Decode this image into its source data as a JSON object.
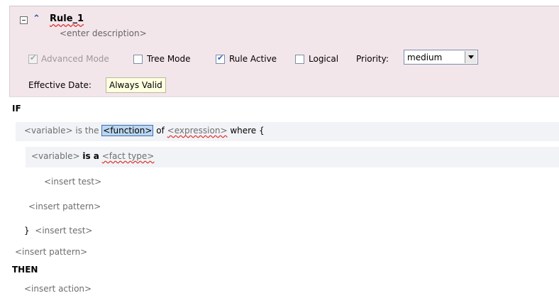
{
  "rule": {
    "name": "Rule_1",
    "description": "<enter description>",
    "options": {
      "advanced_mode": {
        "label": "Advanced Mode",
        "checked": true,
        "disabled": true
      },
      "tree_mode": {
        "label": "Tree Mode",
        "checked": false
      },
      "rule_active": {
        "label": "Rule Active",
        "checked": true
      },
      "logical": {
        "label": "Logical",
        "checked": false
      }
    },
    "priority": {
      "label": "Priority:",
      "value": "medium"
    },
    "effective_date": {
      "label": "Effective Date:",
      "value": "Always Valid"
    }
  },
  "if_section": {
    "keyword": "IF",
    "line1": {
      "variable": "<variable>",
      "is_the": "is the",
      "function": "<function>",
      "of": "of",
      "expression": "<expression>",
      "where": "where {"
    },
    "line2": {
      "variable": "<variable>",
      "is_a": "is a",
      "fact_type": "<fact type>"
    },
    "insert_test_inner": "<insert test>",
    "insert_pattern_inner": "<insert pattern>",
    "close_brace": "}",
    "insert_test_outer": "<insert test>",
    "insert_pattern_outer": "<insert pattern>"
  },
  "then_section": {
    "keyword": "THEN",
    "insert_action": "<insert action>"
  }
}
